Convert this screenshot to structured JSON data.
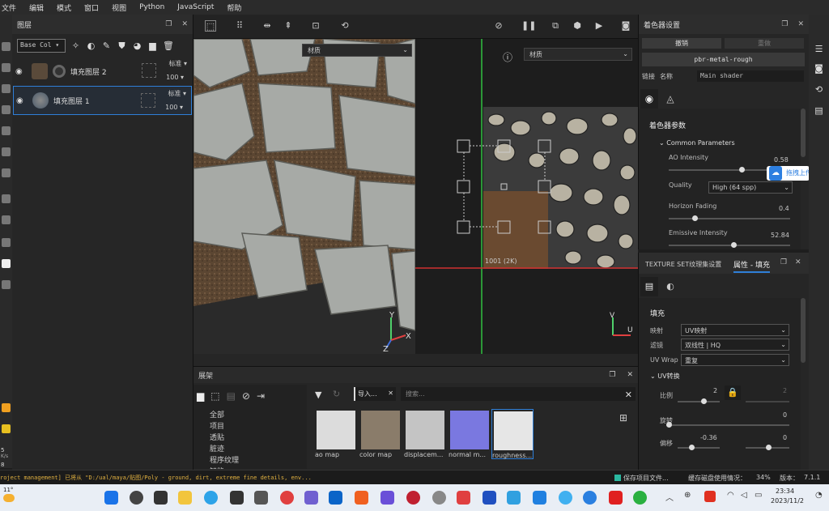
{
  "menu": [
    "文件",
    "编辑",
    "模式",
    "窗口",
    "视图",
    "Python",
    "JavaScript",
    "帮助"
  ],
  "layers_panel": {
    "title": "图层",
    "channel_select": "Base Col",
    "layers": [
      {
        "name": "填充图层 2",
        "blend": "标准",
        "opacity": "100",
        "selected": false
      },
      {
        "name": "填充图层 1",
        "blend": "标准",
        "opacity": "100",
        "selected": true
      }
    ]
  },
  "viewport": {
    "material_select_3d": "材质",
    "material_select_2d": "材质",
    "uv_tile_label": "1001 (2K)",
    "axis_y": "Y",
    "axis_x": "X",
    "axis_z": "Z",
    "axis2d_v": "V",
    "axis2d_u": "U"
  },
  "shelf": {
    "title": "展架",
    "categories": [
      "全部",
      "项目",
      "透贴",
      "脏迹",
      "程序纹理",
      "智能..."
    ],
    "tab_label": "导入...",
    "search_placeholder": "搜索...",
    "items": [
      {
        "name": "ao map",
        "color": "#d8d8d8"
      },
      {
        "name": "color map",
        "color": "#8a7c6a"
      },
      {
        "name": "displacem...",
        "color": "#c9c9c9"
      },
      {
        "name": "normal m...",
        "color": "#7a78e0"
      },
      {
        "name": "roughness...",
        "color": "#e6e6e6"
      }
    ]
  },
  "shader_panel": {
    "title": "着色器设置",
    "undo_label": "撤销",
    "redo_label": "重做",
    "shader_name": "pbr-metal-rough",
    "link_label": "链接",
    "name_label": "名称",
    "name_value": "Main shader",
    "section_title": "着色器参数",
    "group_title": "Common Parameters",
    "params": [
      {
        "label": "AO Intensity",
        "value": "0.58",
        "fraction": 0.58
      },
      {
        "label": "Quality",
        "value": "High (64 spp)"
      },
      {
        "label": "Horizon Fading",
        "value": "0.4",
        "fraction": 0.2
      },
      {
        "label": "Emissive Intensity",
        "value": "52.84",
        "fraction": 0.53
      }
    ],
    "upload_badge": "拖拽上传"
  },
  "texset_panel": {
    "tab1": "TEXTURE SET纹理集设置",
    "tab2": "属性 - 填充",
    "section": "填充",
    "mapping_label": "映射",
    "mapping_value": "UV映射",
    "filter_label": "滤镜",
    "filter_value": "双线性 | HQ",
    "uvwrap_label": "UV Wrap",
    "uvwrap_value": "重复",
    "uvtransform_label": "UV转换",
    "scale_label": "比例",
    "scale_value": "2",
    "scale_value2": "2",
    "rotation_label": "旋转",
    "rotation_value": "0",
    "offset_label": "偏移",
    "offset_value1": "-0.36",
    "offset_value2": "0"
  },
  "statusbar": {
    "log": "roject management] 已将从 \"D:/ual/maya/贴图/Poly - ground, dirt, extreme fine details, env...",
    "saving": "保存项目文件...",
    "cache": "缓存磁盘使用情况：",
    "cache_pct": "34%",
    "version_label": "版本：",
    "version": "7.1.1"
  },
  "left_strip_text": {
    "top": "5",
    "bottom": "8",
    "unit": "K/s"
  },
  "taskbar": {
    "weather": "11°",
    "time": "23:34",
    "date": "2023/11/2"
  }
}
